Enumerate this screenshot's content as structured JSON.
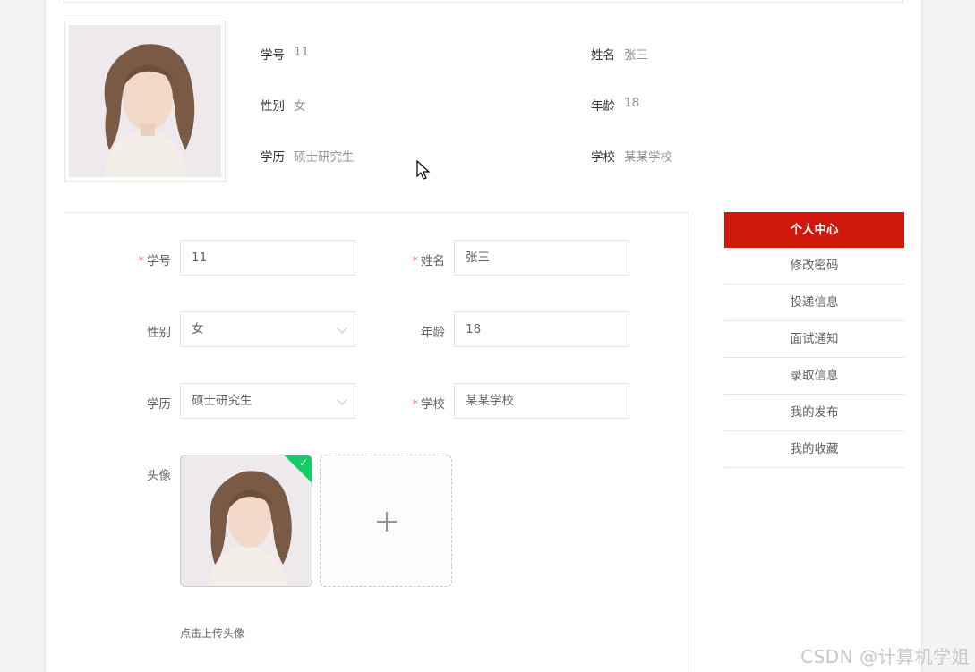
{
  "profile": {
    "fields": [
      {
        "label": "学号",
        "value": "11"
      },
      {
        "label": "姓名",
        "value": "张三"
      },
      {
        "label": "性别",
        "value": "女"
      },
      {
        "label": "年龄",
        "value": "18"
      },
      {
        "label": "学历",
        "value": "硕士研究生"
      },
      {
        "label": "学校",
        "value": "某某学校"
      }
    ]
  },
  "form": {
    "student_id": {
      "label": "学号",
      "value": "11",
      "required": true
    },
    "name": {
      "label": "姓名",
      "value": "张三",
      "required": true
    },
    "gender": {
      "label": "性别",
      "value": "女",
      "required": false
    },
    "age": {
      "label": "年龄",
      "value": "18",
      "required": false
    },
    "education": {
      "label": "学历",
      "value": "硕士研究生",
      "required": false
    },
    "school": {
      "label": "学校",
      "value": "某某学校",
      "required": true
    },
    "avatar": {
      "label": "头像",
      "upload_tip": "点击上传头像"
    },
    "required_mark": "*"
  },
  "side_menu": {
    "items": [
      {
        "label": "个人中心",
        "active": true
      },
      {
        "label": "修改密码",
        "active": false
      },
      {
        "label": "投递信息",
        "active": false
      },
      {
        "label": "面试通知",
        "active": false
      },
      {
        "label": "录取信息",
        "active": false
      },
      {
        "label": "我的发布",
        "active": false
      },
      {
        "label": "我的收藏",
        "active": false
      }
    ]
  },
  "watermark": "CSDN @计算机学姐",
  "colors": {
    "accent": "#d0190c",
    "required": "#f56c6c",
    "success": "#13ce66"
  }
}
